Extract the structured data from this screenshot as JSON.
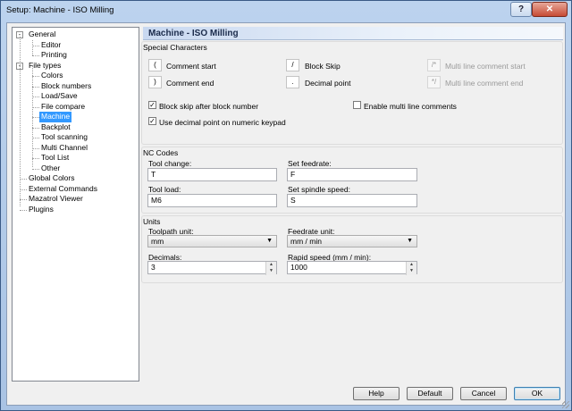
{
  "window": {
    "title": "Setup: Machine - ISO Milling"
  },
  "tree": {
    "items": [
      {
        "label": "General",
        "level": 0,
        "expander": "-"
      },
      {
        "label": "Editor",
        "level": 1
      },
      {
        "label": "Printing",
        "level": 1
      },
      {
        "label": "File types",
        "level": 0,
        "expander": "-"
      },
      {
        "label": "Colors",
        "level": 1
      },
      {
        "label": "Block numbers",
        "level": 1
      },
      {
        "label": "Load/Save",
        "level": 1
      },
      {
        "label": "File compare",
        "level": 1
      },
      {
        "label": "Machine",
        "level": 1,
        "selected": true
      },
      {
        "label": "Backplot",
        "level": 1
      },
      {
        "label": "Tool scanning",
        "level": 1
      },
      {
        "label": "Multi Channel",
        "level": 1
      },
      {
        "label": "Tool List",
        "level": 1
      },
      {
        "label": "Other",
        "level": 1
      },
      {
        "label": "Global Colors",
        "level": 0
      },
      {
        "label": "External Commands",
        "level": 0
      },
      {
        "label": "Mazatrol Viewer",
        "level": 0
      },
      {
        "label": "Plugins",
        "level": 0
      }
    ]
  },
  "panel": {
    "title": "Machine - ISO Milling"
  },
  "special": {
    "label": "Special Characters",
    "comment_start": {
      "key": "(",
      "label": "Comment start"
    },
    "comment_end": {
      "key": ")",
      "label": "Comment end"
    },
    "block_skip": {
      "key": "/",
      "label": "Block Skip"
    },
    "decimal_point": {
      "key": ".",
      "label": "Decimal point"
    },
    "ml_comment_start": {
      "key": "/*",
      "label": "Multi line comment start"
    },
    "ml_comment_end": {
      "key": "*/",
      "label": "Multi line comment end"
    },
    "chk_block_skip": {
      "label": "Block skip after block number",
      "checked": true
    },
    "chk_decimal": {
      "label": "Use decimal point on numeric keypad",
      "checked": true
    },
    "chk_multiline": {
      "label": "Enable multi line comments",
      "checked": false
    }
  },
  "nc": {
    "label": "NC Codes",
    "tool_change": {
      "label": "Tool change:",
      "value": "T"
    },
    "set_feedrate": {
      "label": "Set feedrate:",
      "value": "F"
    },
    "tool_load": {
      "label": "Tool load:",
      "value": "M6"
    },
    "set_spindle": {
      "label": "Set spindle speed:",
      "value": "S"
    }
  },
  "units": {
    "label": "Units",
    "toolpath_unit": {
      "label": "Toolpath unit:",
      "value": "mm"
    },
    "feedrate_unit": {
      "label": "Feedrate unit:",
      "value": "mm / min"
    },
    "decimals": {
      "label": "Decimals:",
      "value": "3"
    },
    "rapid_speed": {
      "label": "Rapid speed (mm / min):",
      "value": "1000"
    }
  },
  "buttons": {
    "help": "Help",
    "default": "Default",
    "cancel": "Cancel",
    "ok": "OK"
  }
}
